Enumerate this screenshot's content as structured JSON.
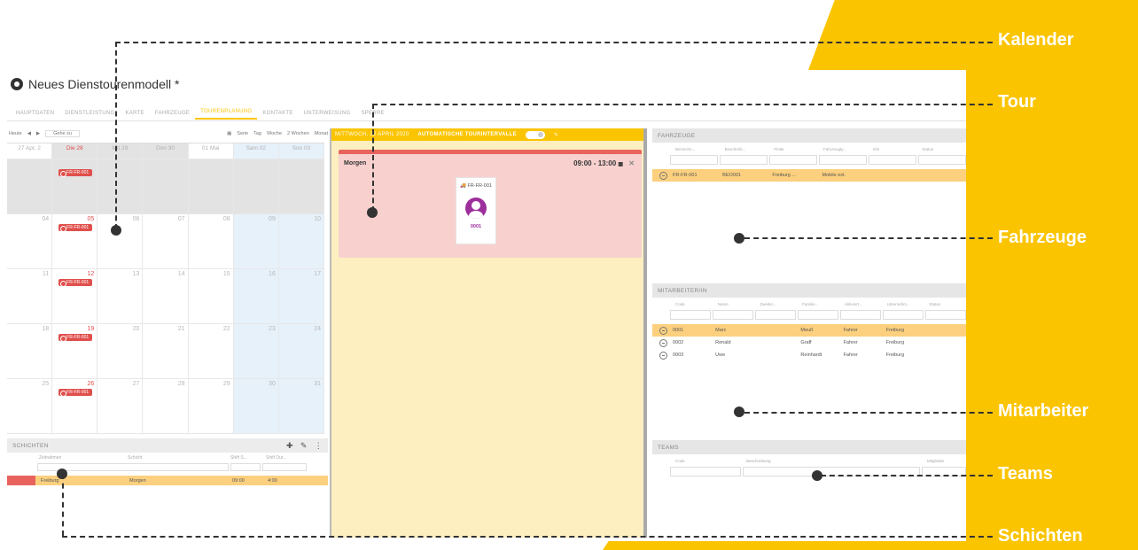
{
  "brand_color": "#fbc400",
  "app": {
    "title": "Neues Dienstourenmodell *",
    "tabs": [
      "Hauptdaten",
      "Dienstleistung",
      "Karte",
      "Fahrzeuge",
      "Tourenplanung",
      "Kontakte",
      "Unterweisung",
      "Sperre"
    ],
    "active_tab_index": 4
  },
  "calendar": {
    "toolbar": {
      "today": "Heute",
      "goto": "Gehe zu",
      "views": [
        "Serie",
        "Tag",
        "Woche",
        "2 Wochen",
        "Monat"
      ]
    },
    "day_headers": [
      "27 Apr, 2",
      "Die 28",
      "Mit 29",
      "Don 30",
      "01 Mai",
      "Sam 02",
      "Son 03"
    ],
    "weeks": [
      [
        "",
        "",
        "",
        "",
        "",
        "",
        ""
      ],
      [
        "04",
        "05",
        "06",
        "07",
        "08",
        "09",
        "10"
      ],
      [
        "11",
        "12",
        "13",
        "14",
        "15",
        "16",
        "17"
      ],
      [
        "18",
        "19",
        "20",
        "21",
        "22",
        "23",
        "24"
      ],
      [
        "25",
        "26",
        "27",
        "28",
        "29",
        "30",
        "31"
      ]
    ],
    "event_label": "FR-FR-001"
  },
  "schichten": {
    "title": "SCHICHTEN",
    "columns": [
      "Zeitrahmen",
      "Schicht",
      "Shift S...",
      "Shift Dur..."
    ],
    "rows": [
      {
        "zeitrahmen": "Freiburg",
        "schicht": "Morgen",
        "start": "09:00",
        "dauer": "4:00"
      }
    ]
  },
  "tour": {
    "date": "MITTWOCH, 22 APRIL 2020",
    "auto_label": "AUTOMATISCHE TOURINTERVALLE",
    "shift_name": "Morgen",
    "shift_time": "09:00 - 13:00",
    "vehicle": "FR-FR-001",
    "employee_code": "0001"
  },
  "fahrzeuge": {
    "title": "FAHRZEUGE",
    "columns": [
      "Bezeichn...",
      "Beschreib...",
      "Flotte",
      "Fahrzeugty...",
      "Info",
      "Status"
    ],
    "rows": [
      [
        "FR-FR-001",
        "BEO001",
        "Freiburg ...",
        "Mobile ext.",
        "",
        ""
      ]
    ]
  },
  "mitarbeiter": {
    "title": "MITARBEITER/IN",
    "columns": [
      "Code",
      "Name",
      "Zweiter...",
      "Familie...",
      "Aktiviert...",
      "Unternehm...",
      "Status"
    ],
    "rows": [
      [
        "0001",
        "Marc",
        "",
        "Meuß",
        "Fahrer",
        "Freiburg",
        ""
      ],
      [
        "0002",
        "Renald",
        "",
        "Graff",
        "Fahrer",
        "Freiburg",
        ""
      ],
      [
        "0003",
        "Uwe",
        "",
        "Reinhardt",
        "Fahrer",
        "Freiburg",
        ""
      ]
    ]
  },
  "teams": {
    "title": "TEAMS",
    "columns": [
      "Code",
      "Beschreibung",
      "Mitglieder"
    ]
  },
  "callouts": {
    "kalender": "Kalender",
    "tour": "Tour",
    "fahrzeuge": "Fahrzeuge",
    "mitarbeiter": "Mitarbeiter",
    "teams": "Teams",
    "schichten": "Schichten"
  }
}
